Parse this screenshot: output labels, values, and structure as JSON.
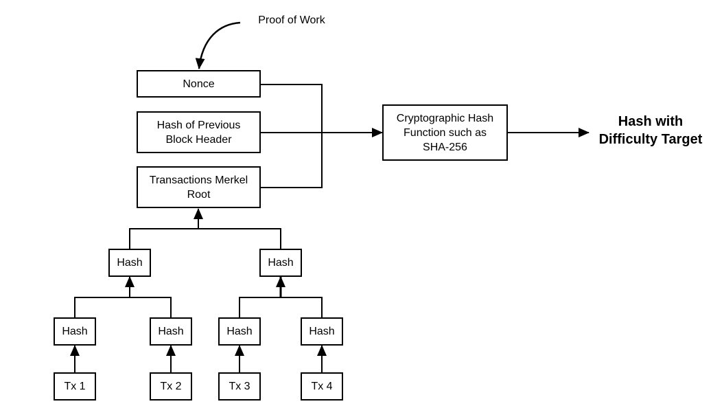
{
  "diagram": {
    "annotation": "Proof of Work",
    "header_fields": {
      "nonce": "Nonce",
      "prev_hash": "Hash of Previous Block Header",
      "merkle_root": "Transactions Merkel Root"
    },
    "hash_function": "Cryptographic Hash Function such as SHA-256",
    "result": "Hash with Difficulty Target",
    "merkle_tree": {
      "level1": [
        "Hash",
        "Hash"
      ],
      "level2": [
        "Hash",
        "Hash",
        "Hash",
        "Hash"
      ],
      "transactions": [
        "Tx 1",
        "Tx 2",
        "Tx 3",
        "Tx 4"
      ]
    }
  },
  "colors": {
    "stroke": "#000000",
    "background": "#ffffff"
  }
}
